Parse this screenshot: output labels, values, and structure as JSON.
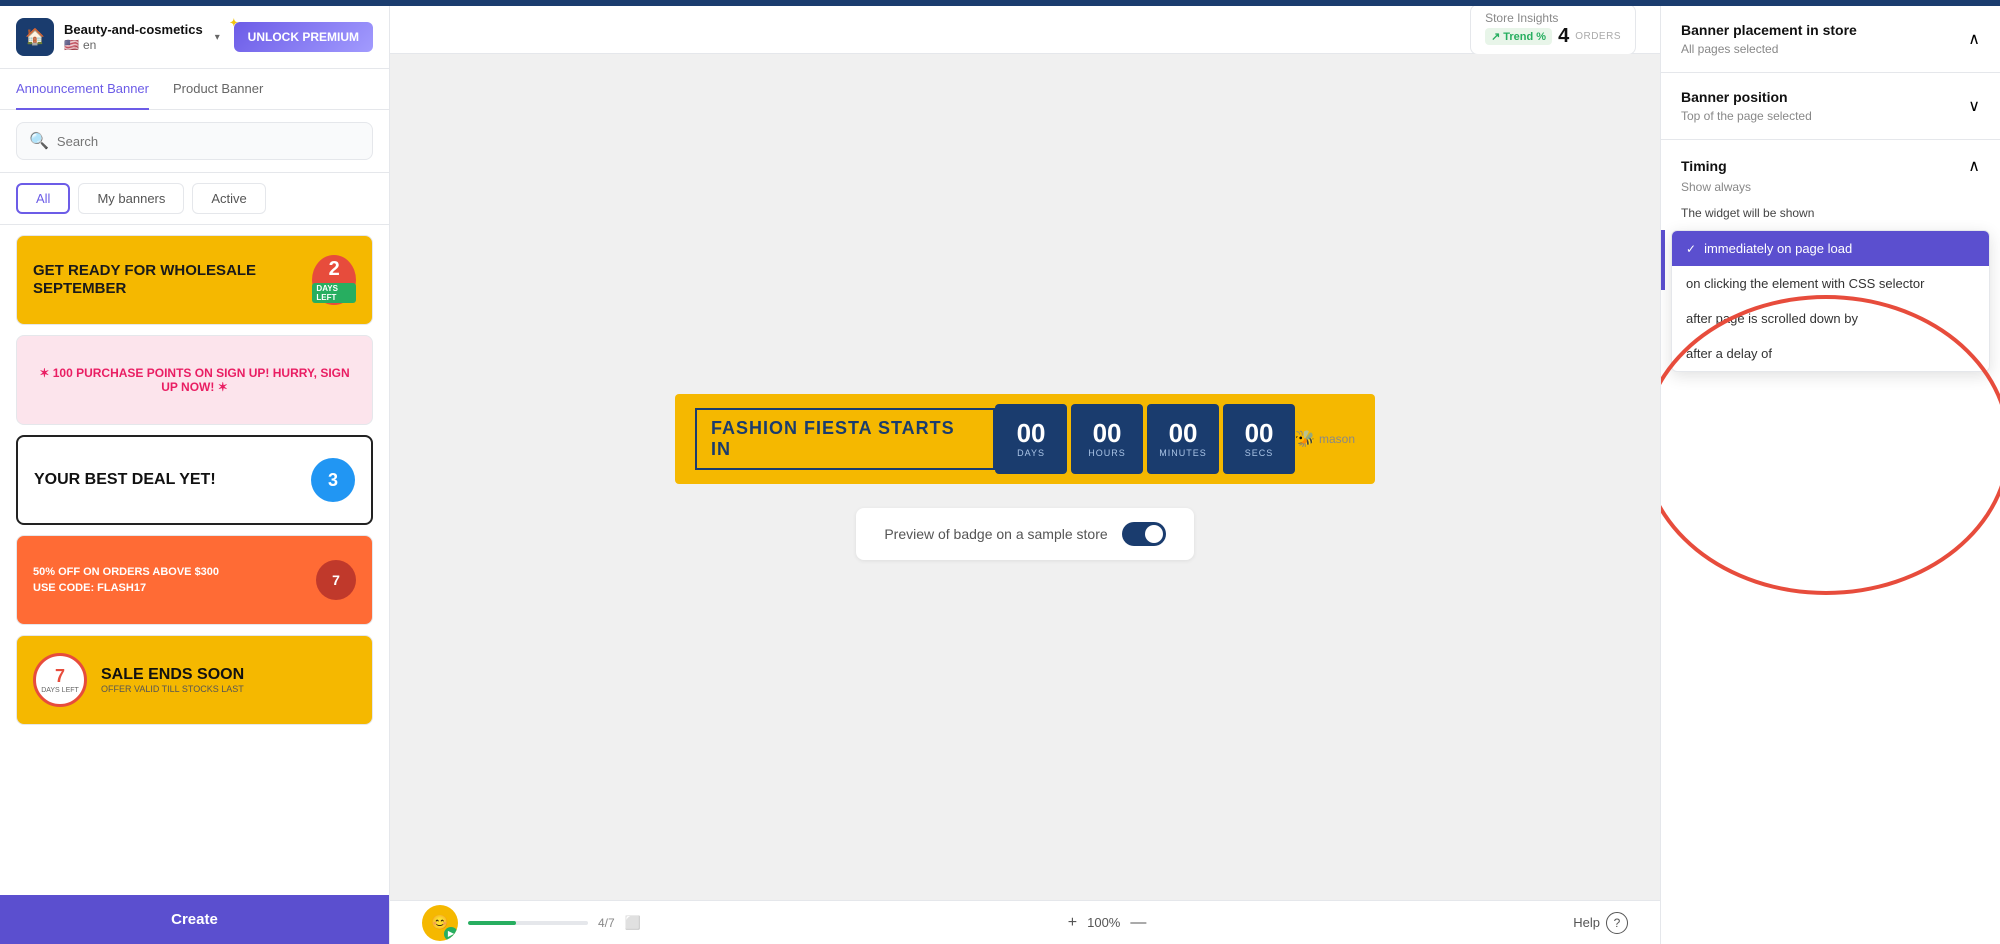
{
  "topBar": {
    "color": "#1a3c6e"
  },
  "sidebar": {
    "storeName": "Beauty-and-cosmetics",
    "storeLang": "en",
    "unlockBtn": "UNLOCK PREMIUM",
    "tabs": [
      {
        "label": "Announcement Banner",
        "active": true
      },
      {
        "label": "Product Banner",
        "active": false
      }
    ],
    "search": {
      "placeholder": "Search"
    },
    "filters": [
      {
        "label": "All",
        "selected": true
      },
      {
        "label": "My banners",
        "selected": false
      },
      {
        "label": "Active",
        "selected": false
      }
    ],
    "banners": [
      {
        "id": "banner-1",
        "type": "wholesale",
        "text": "GET READY FOR WHOLESALE SEPTEMBER",
        "badgeNum": "2",
        "badgeLabel": "DAYS LEFT"
      },
      {
        "id": "banner-2",
        "type": "points",
        "text": "✶ 100 PURCHASE POINTS ON SIGN UP! HURRY, SIGN UP NOW! ✶"
      },
      {
        "id": "banner-3",
        "type": "deal",
        "text": "YOUR BEST DEAL YET!",
        "badgeNum": "3"
      },
      {
        "id": "banner-4",
        "type": "flash",
        "text": "50% OFF ON ORDERS ABOVE $300",
        "codeText": "USE CODE: FLASH17",
        "badgeNum": "7"
      },
      {
        "id": "banner-5",
        "type": "sale",
        "countNum": "7",
        "countUnit": "DAYS LEFT",
        "saleTitle": "SALE ENDS SOON",
        "saleSub": "OFFER VALID TILL STOCKS LAST"
      }
    ],
    "createBtn": "Create"
  },
  "storeInsights": {
    "label": "Store Insights",
    "trendLabel": "Trend %",
    "ordersCount": "4",
    "ordersLabel": "ORDERS"
  },
  "preview": {
    "bannerText": "FASHION FIESTA STARTS IN",
    "countdown": {
      "days": "00",
      "daysLabel": "DAYS",
      "hours": "00",
      "hoursLabel": "HOURS",
      "minutes": "00",
      "minutesLabel": "MINUTES",
      "seconds": "00",
      "secondsLabel": "SECS"
    },
    "badgeLabel": "Preview of badge on a sample store",
    "masonLabel": "mason"
  },
  "bottomBar": {
    "progressValue": 40,
    "pageIndicator": "4/7",
    "plusLabel": "+",
    "zoomLabel": "100%",
    "minusLabel": "—",
    "helpLabel": "Help"
  },
  "rightPanel": {
    "bannerPlacement": {
      "title": "Banner placement in store",
      "subtitle": "All pages selected"
    },
    "bannerPosition": {
      "title": "Banner position",
      "subtitle": "Top of the page selected"
    },
    "timing": {
      "title": "Timing",
      "subtitle": "Show always",
      "widgetShownLabel": "The widget will be shown",
      "dropdown": {
        "options": [
          {
            "label": "immediately on page load",
            "selected": true
          },
          {
            "label": "on clicking the element with CSS selector",
            "selected": false
          },
          {
            "label": "after page is scrolled down by",
            "selected": false
          },
          {
            "label": "after a delay of",
            "selected": false
          }
        ]
      }
    }
  }
}
